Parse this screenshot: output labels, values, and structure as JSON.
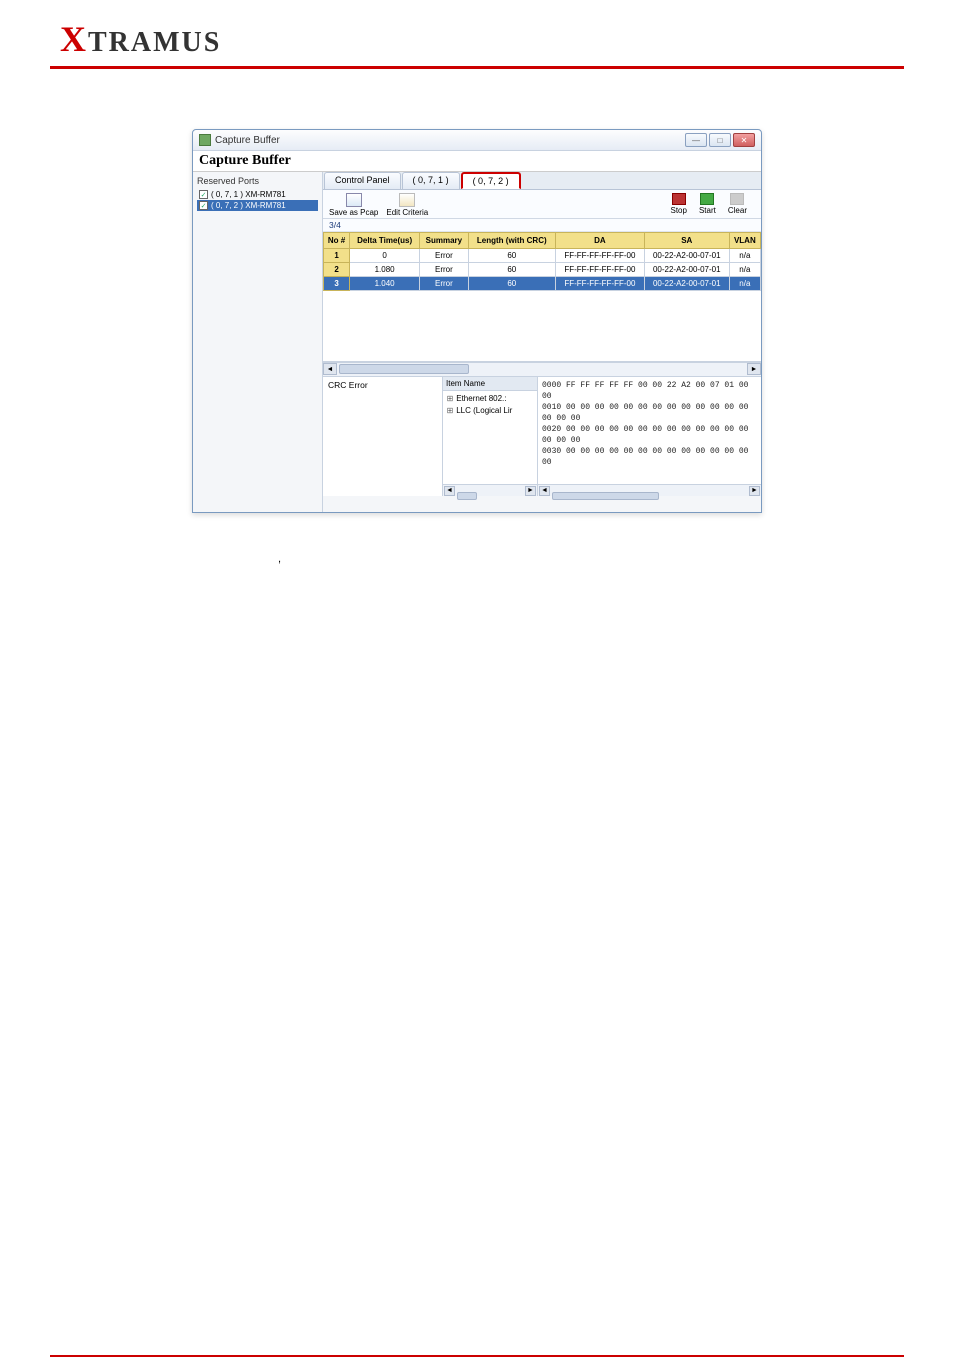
{
  "logo": {
    "prefix": "X",
    "rest": "TRAMUS"
  },
  "window": {
    "title": "Capture Buffer",
    "big_title": "Capture Buffer",
    "left": {
      "title": "Reserved Ports",
      "ports": [
        {
          "label": "( 0, 7, 1 ) XM-RM781",
          "checked": true,
          "selected": false
        },
        {
          "label": "( 0, 7, 2 ) XM-RM781",
          "checked": true,
          "selected": true
        }
      ]
    },
    "tabs": [
      {
        "label": "Control Panel",
        "active": false
      },
      {
        "label": "( 0, 7, 1 )",
        "active": false
      },
      {
        "label": "( 0, 7, 2 )",
        "active": true
      }
    ],
    "toolbar": {
      "save": "Save as Pcap",
      "edit": "Edit Criteria",
      "stop": "Stop",
      "start": "Start",
      "clear": "Clear"
    },
    "count": "3/4",
    "columns": [
      "No #",
      "Delta Time(us)",
      "Summary",
      "Length (with CRC)",
      "DA",
      "SA",
      "VLAN"
    ],
    "rows": [
      {
        "no": "1",
        "dt": "0",
        "sum": "Error",
        "len": "60",
        "da": "FF-FF-FF-FF-FF-00",
        "sa": "00-22-A2-00-07-01",
        "vlan": "n/a",
        "sel": false
      },
      {
        "no": "2",
        "dt": "1.080",
        "sum": "Error",
        "len": "60",
        "da": "FF-FF-FF-FF-FF-00",
        "sa": "00-22-A2-00-07-01",
        "vlan": "n/a",
        "sel": false
      },
      {
        "no": "3",
        "dt": "1.040",
        "sum": "Error",
        "len": "60",
        "da": "FF-FF-FF-FF-FF-00",
        "sa": "00-22-A2-00-07-01",
        "vlan": "n/a",
        "sel": true
      }
    ],
    "detail": {
      "left_title": "CRC Error",
      "mid_head": "Item Name",
      "mid_items": [
        "Ethernet 802.:",
        "LLC (Logical Lir"
      ],
      "hex": [
        "0000  FF FF FF FF FF 00 00 22 A2 00 07 01 00 00",
        "0010  00 00 00 00 00 00 00 00 00 00 00 00 00 00 00 00",
        "0020  00 00 00 00 00 00 00 00 00 00 00 00 00 00 00 00",
        "0030  00 00 00 00 00 00 00 00 00 00 00 00 00 00"
      ]
    }
  }
}
